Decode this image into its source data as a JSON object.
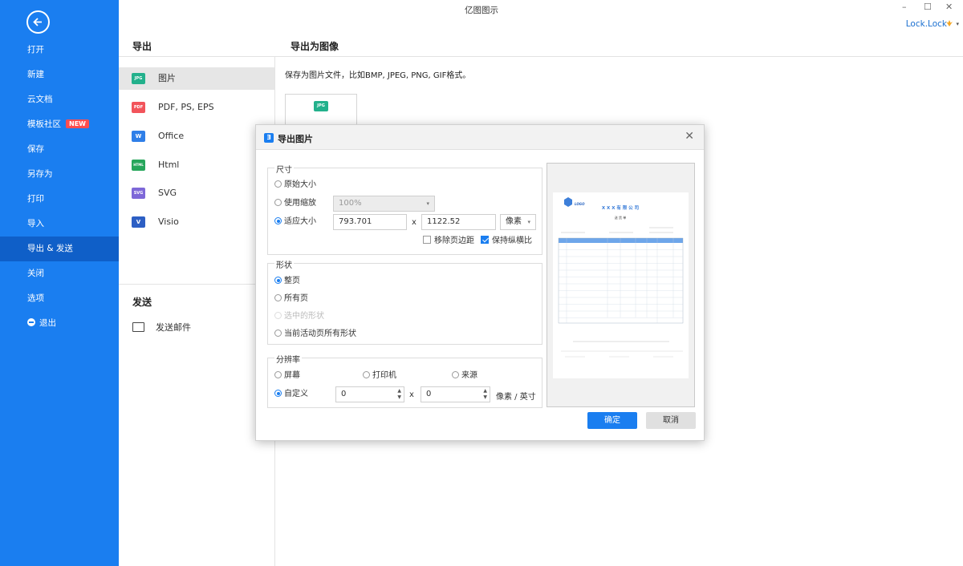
{
  "app": {
    "title": "亿图图示",
    "window_controls": {
      "minimize": "–",
      "maximize": "☐",
      "close": "✕"
    },
    "user": {
      "name": "Lock.Lock",
      "caret": "▾"
    }
  },
  "sidebar": {
    "items": [
      {
        "label": "打开"
      },
      {
        "label": "新建"
      },
      {
        "label": "云文档"
      },
      {
        "label": "模板社区",
        "badge": "NEW"
      },
      {
        "label": "保存"
      },
      {
        "label": "另存为"
      },
      {
        "label": "打印"
      },
      {
        "label": "导入"
      },
      {
        "label": "导出 & 发送"
      },
      {
        "label": "关闭"
      },
      {
        "label": "选项"
      },
      {
        "label": "退出"
      }
    ]
  },
  "export_panel": {
    "title": "导出",
    "formats": [
      {
        "label": "图片",
        "icon_text": "JPG",
        "color": "#23b18c"
      },
      {
        "label": "PDF, PS, EPS",
        "icon_text": "PDF",
        "color": "#f2545b"
      },
      {
        "label": "Office",
        "icon_text": "W",
        "color": "#2f7fe8"
      },
      {
        "label": "Html",
        "icon_text": "HTML",
        "color": "#26a65b"
      },
      {
        "label": "SVG",
        "icon_text": "SVG",
        "color": "#7e68d8"
      },
      {
        "label": "Visio",
        "icon_text": "V",
        "color": "#2d5fc4"
      }
    ],
    "send_title": "发送",
    "send_mail": "发送邮件"
  },
  "main": {
    "title": "导出为图像",
    "description": "保存为图片文件，比如BMP, JPEG, PNG, GIF格式。",
    "thumb_icon": "JPG"
  },
  "dialog": {
    "title": "导出图片",
    "close": "✕",
    "size": {
      "legend": "尺寸",
      "original": "原始大小",
      "use_zoom": "使用缩放",
      "zoom_value": "100%",
      "fit_size": "适应大小",
      "width": "793.701",
      "times": "x",
      "height": "1122.52",
      "unit": "像素",
      "remove_margin": "移除页边距",
      "keep_ratio": "保持纵横比"
    },
    "shape": {
      "legend": "形状",
      "whole_page": "整页",
      "all_pages": "所有页",
      "selected": "选中的形状",
      "current_page_shapes": "当前活动页所有形状"
    },
    "resolution": {
      "legend": "分辨率",
      "screen": "屏幕",
      "printer": "打印机",
      "source": "来源",
      "custom": "自定义",
      "x_value": "0",
      "times": "x",
      "y_value": "0",
      "unit": "像素 / 英寸"
    },
    "ok": "确定",
    "cancel": "取消",
    "preview_doc": {
      "logo": "LOGO",
      "company": "X X X 有 限 公 司",
      "doc_title": "送 货 单"
    }
  }
}
